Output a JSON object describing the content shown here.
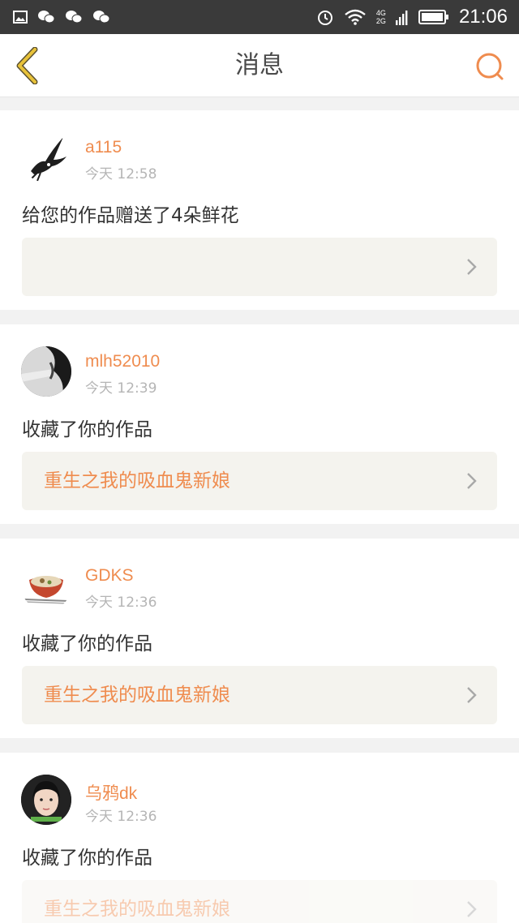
{
  "status_bar": {
    "time": "21:06",
    "network_top": "4G",
    "network_bottom": "2G",
    "icons": [
      "image-icon",
      "wechat-icon",
      "wechat-icon",
      "wechat-icon",
      "alarm-icon",
      "wifi-icon",
      "signal-icon",
      "battery-icon"
    ]
  },
  "header": {
    "title": "消息",
    "back_icon": "chevron-left-icon",
    "search_icon": "search-icon"
  },
  "colors": {
    "accent": "#ef8c4f",
    "back_arrow": "#e8c23a",
    "work_box_bg": "#f4f3ee",
    "status_bar_bg": "#3a3a3a"
  },
  "messages": [
    {
      "username": "a115",
      "time": "今天 12:58",
      "text": "给您的作品赠送了4朵鲜花",
      "work_title": ""
    },
    {
      "username": "mlh52010",
      "time": "今天 12:39",
      "text": "收藏了你的作品",
      "work_title": "重生之我的吸血鬼新娘"
    },
    {
      "username": "GDKS",
      "time": "今天 12:36",
      "text": "收藏了你的作品",
      "work_title": "重生之我的吸血鬼新娘"
    },
    {
      "username": "乌鸦dk",
      "time": "今天 12:36",
      "text": "收藏了你的作品",
      "work_title": "重生之我的吸血鬼新娘"
    }
  ]
}
